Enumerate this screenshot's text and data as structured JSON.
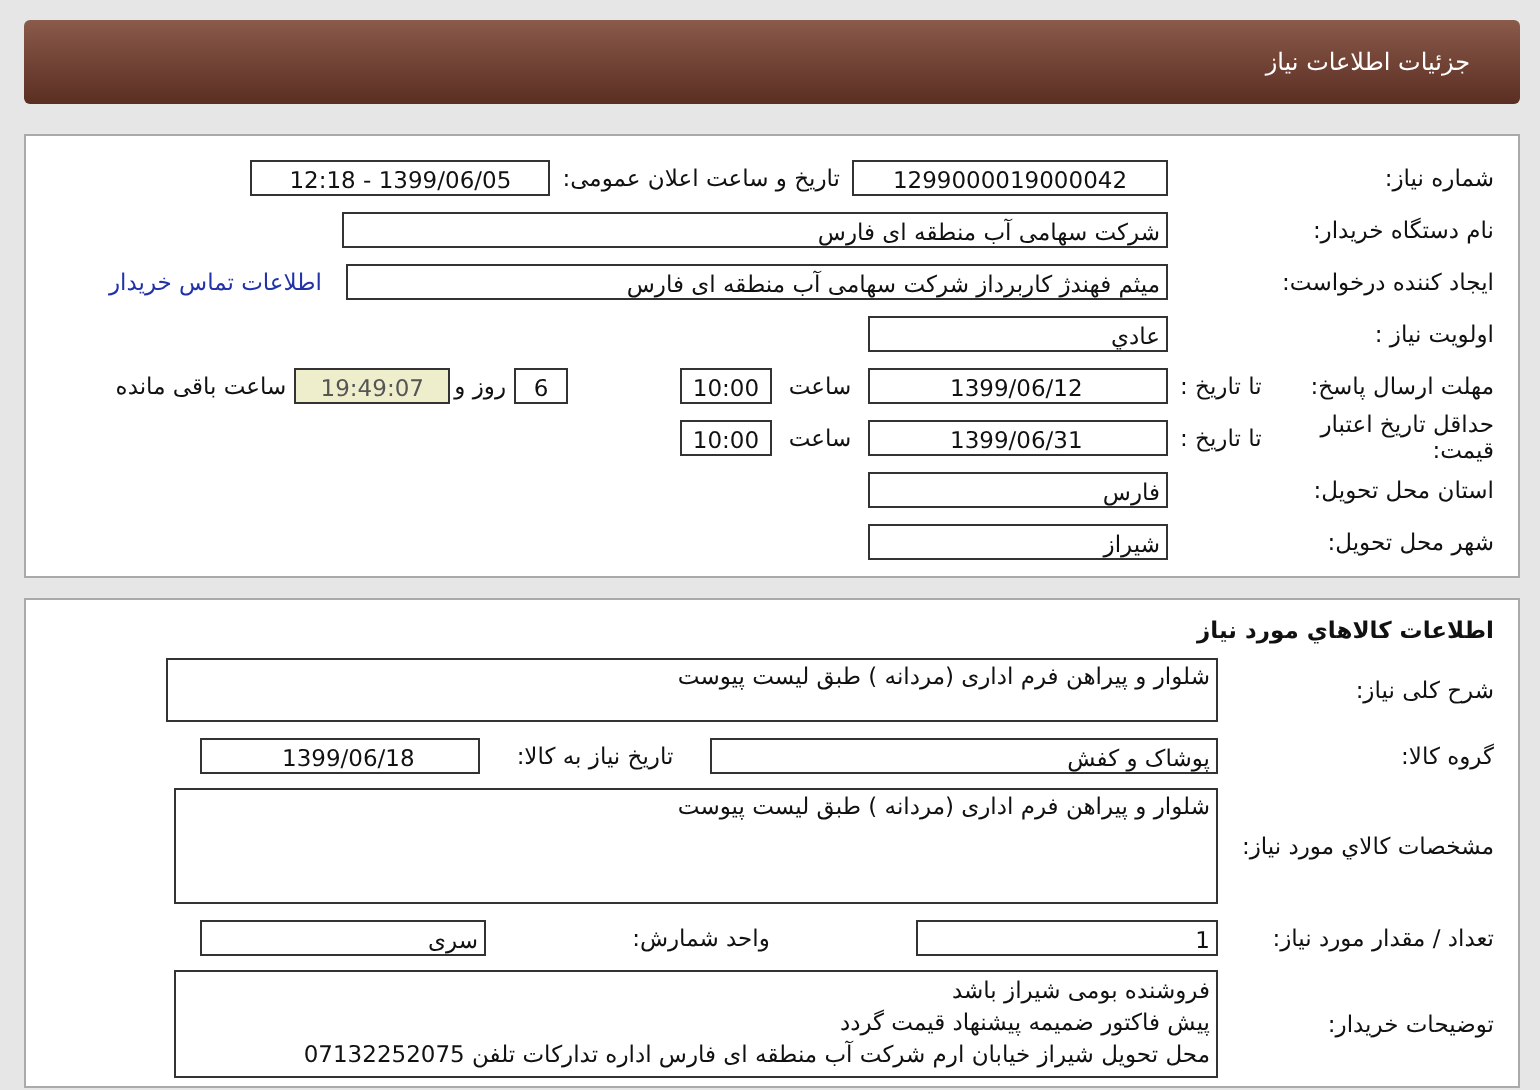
{
  "header": {
    "title": "جزئیات اطلاعات نیاز"
  },
  "need_info": {
    "need_number_label": "شماره نیاز:",
    "need_number": "1299000019000042",
    "announce_label": "تاریخ و ساعت اعلان عمومی:",
    "announce_datetime": "1399/06/05 - 12:18",
    "buyer_org_label": "نام دستگاه خریدار:",
    "buyer_org": "شرکت سهامی آب منطقه ای فارس",
    "creator_label": "ایجاد کننده درخواست:",
    "creator": "میثم فهندژ کاربرداز شرکت سهامی آب منطقه ای فارس",
    "contact_link": "اطلاعات تماس خریدار",
    "priority_label": "اولویت نیاز :",
    "priority": "عادي",
    "deadline_label": "مهلت ارسال پاسخ:",
    "deadline_to_label": "تا تاریخ :",
    "deadline_date": "1399/06/12",
    "deadline_time_label": "ساعت",
    "deadline_time": "10:00",
    "days": "6",
    "days_label": "روز و",
    "remaining_time": "19:49:07",
    "remaining_label": "ساعت باقی مانده",
    "validity_label": "حداقل تاریخ اعتبار قیمت:",
    "validity_to_label": "تا تاریخ :",
    "validity_date": "1399/06/31",
    "validity_time_label": "ساعت",
    "validity_time": "10:00",
    "province_label": "استان محل تحویل:",
    "province": "فارس",
    "city_label": "شهر محل تحویل:",
    "city": "شیراز"
  },
  "goods": {
    "heading": "اطلاعات کالاهاي مورد نیاز",
    "summary_label": "شرح کلی نیاز:",
    "summary": "شلوار و پیراهن فرم اداری (مردانه ) طبق لیست پیوست",
    "group_label": "گروه کالا:",
    "group": "پوشاک و کفش",
    "need_date_label": "تاریخ نیاز به کالا:",
    "need_date": "1399/06/18",
    "specs_label": "مشخصات کالاي مورد نیاز:",
    "specs": "شلوار و پیراهن فرم اداری (مردانه ) طبق لیست پیوست",
    "quantity_label": "تعداد / مقدار مورد نیاز:",
    "quantity": "1",
    "unit_label": "واحد شمارش:",
    "unit": "سری",
    "notes_label": "توضیحات خریدار:",
    "notes": [
      "فروشنده بومی شیراز باشد",
      "پیش فاکتور ضمیمه پیشنهاد قیمت گردد",
      "محل تحویل شیراز خیابان ارم شرکت آب منطقه ای فارس اداره تدارکات تلفن 07132252075"
    ]
  }
}
